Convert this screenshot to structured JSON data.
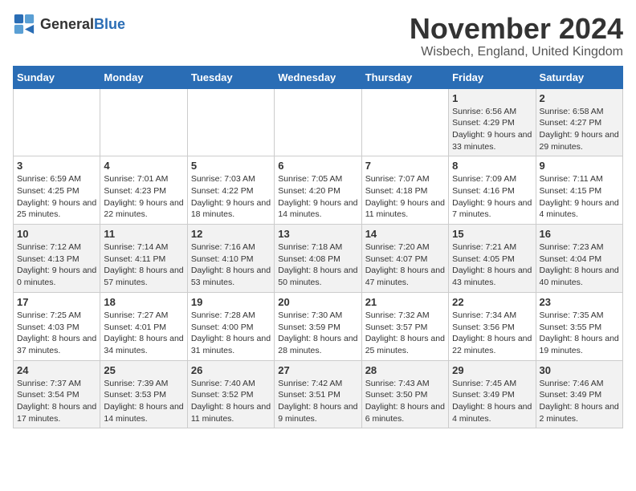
{
  "logo": {
    "general": "General",
    "blue": "Blue"
  },
  "title": "November 2024",
  "location": "Wisbech, England, United Kingdom",
  "headers": [
    "Sunday",
    "Monday",
    "Tuesday",
    "Wednesday",
    "Thursday",
    "Friday",
    "Saturday"
  ],
  "weeks": [
    [
      {
        "day": "",
        "info": ""
      },
      {
        "day": "",
        "info": ""
      },
      {
        "day": "",
        "info": ""
      },
      {
        "day": "",
        "info": ""
      },
      {
        "day": "",
        "info": ""
      },
      {
        "day": "1",
        "info": "Sunrise: 6:56 AM\nSunset: 4:29 PM\nDaylight: 9 hours and 33 minutes."
      },
      {
        "day": "2",
        "info": "Sunrise: 6:58 AM\nSunset: 4:27 PM\nDaylight: 9 hours and 29 minutes."
      }
    ],
    [
      {
        "day": "3",
        "info": "Sunrise: 6:59 AM\nSunset: 4:25 PM\nDaylight: 9 hours and 25 minutes."
      },
      {
        "day": "4",
        "info": "Sunrise: 7:01 AM\nSunset: 4:23 PM\nDaylight: 9 hours and 22 minutes."
      },
      {
        "day": "5",
        "info": "Sunrise: 7:03 AM\nSunset: 4:22 PM\nDaylight: 9 hours and 18 minutes."
      },
      {
        "day": "6",
        "info": "Sunrise: 7:05 AM\nSunset: 4:20 PM\nDaylight: 9 hours and 14 minutes."
      },
      {
        "day": "7",
        "info": "Sunrise: 7:07 AM\nSunset: 4:18 PM\nDaylight: 9 hours and 11 minutes."
      },
      {
        "day": "8",
        "info": "Sunrise: 7:09 AM\nSunset: 4:16 PM\nDaylight: 9 hours and 7 minutes."
      },
      {
        "day": "9",
        "info": "Sunrise: 7:11 AM\nSunset: 4:15 PM\nDaylight: 9 hours and 4 minutes."
      }
    ],
    [
      {
        "day": "10",
        "info": "Sunrise: 7:12 AM\nSunset: 4:13 PM\nDaylight: 9 hours and 0 minutes."
      },
      {
        "day": "11",
        "info": "Sunrise: 7:14 AM\nSunset: 4:11 PM\nDaylight: 8 hours and 57 minutes."
      },
      {
        "day": "12",
        "info": "Sunrise: 7:16 AM\nSunset: 4:10 PM\nDaylight: 8 hours and 53 minutes."
      },
      {
        "day": "13",
        "info": "Sunrise: 7:18 AM\nSunset: 4:08 PM\nDaylight: 8 hours and 50 minutes."
      },
      {
        "day": "14",
        "info": "Sunrise: 7:20 AM\nSunset: 4:07 PM\nDaylight: 8 hours and 47 minutes."
      },
      {
        "day": "15",
        "info": "Sunrise: 7:21 AM\nSunset: 4:05 PM\nDaylight: 8 hours and 43 minutes."
      },
      {
        "day": "16",
        "info": "Sunrise: 7:23 AM\nSunset: 4:04 PM\nDaylight: 8 hours and 40 minutes."
      }
    ],
    [
      {
        "day": "17",
        "info": "Sunrise: 7:25 AM\nSunset: 4:03 PM\nDaylight: 8 hours and 37 minutes."
      },
      {
        "day": "18",
        "info": "Sunrise: 7:27 AM\nSunset: 4:01 PM\nDaylight: 8 hours and 34 minutes."
      },
      {
        "day": "19",
        "info": "Sunrise: 7:28 AM\nSunset: 4:00 PM\nDaylight: 8 hours and 31 minutes."
      },
      {
        "day": "20",
        "info": "Sunrise: 7:30 AM\nSunset: 3:59 PM\nDaylight: 8 hours and 28 minutes."
      },
      {
        "day": "21",
        "info": "Sunrise: 7:32 AM\nSunset: 3:57 PM\nDaylight: 8 hours and 25 minutes."
      },
      {
        "day": "22",
        "info": "Sunrise: 7:34 AM\nSunset: 3:56 PM\nDaylight: 8 hours and 22 minutes."
      },
      {
        "day": "23",
        "info": "Sunrise: 7:35 AM\nSunset: 3:55 PM\nDaylight: 8 hours and 19 minutes."
      }
    ],
    [
      {
        "day": "24",
        "info": "Sunrise: 7:37 AM\nSunset: 3:54 PM\nDaylight: 8 hours and 17 minutes."
      },
      {
        "day": "25",
        "info": "Sunrise: 7:39 AM\nSunset: 3:53 PM\nDaylight: 8 hours and 14 minutes."
      },
      {
        "day": "26",
        "info": "Sunrise: 7:40 AM\nSunset: 3:52 PM\nDaylight: 8 hours and 11 minutes."
      },
      {
        "day": "27",
        "info": "Sunrise: 7:42 AM\nSunset: 3:51 PM\nDaylight: 8 hours and 9 minutes."
      },
      {
        "day": "28",
        "info": "Sunrise: 7:43 AM\nSunset: 3:50 PM\nDaylight: 8 hours and 6 minutes."
      },
      {
        "day": "29",
        "info": "Sunrise: 7:45 AM\nSunset: 3:49 PM\nDaylight: 8 hours and 4 minutes."
      },
      {
        "day": "30",
        "info": "Sunrise: 7:46 AM\nSunset: 3:49 PM\nDaylight: 8 hours and 2 minutes."
      }
    ]
  ]
}
